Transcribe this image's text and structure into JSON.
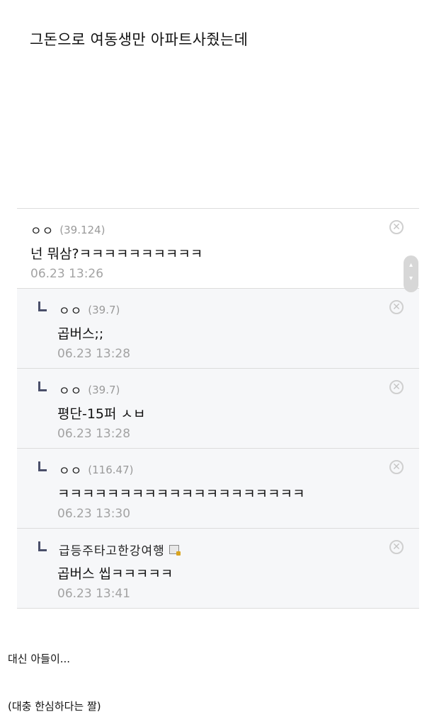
{
  "headline": "그돈으로 여동생만 아파트사줬는데",
  "delete_symbol": "✕",
  "scroll": {
    "up": "▴",
    "down": "▾"
  },
  "comments": [
    {
      "nickname": "ㅇㅇ",
      "ip": "(39.124)",
      "body": "넌 뭐삼?ㅋㅋㅋㅋㅋㅋㅋㅋㅋㅋ",
      "time": "06.23 13:26",
      "is_reply": false
    },
    {
      "nickname": "ㅇㅇ",
      "ip": "(39.7)",
      "body": "곱버스;;",
      "time": "06.23 13:28",
      "is_reply": true
    },
    {
      "nickname": "ㅇㅇ",
      "ip": "(39.7)",
      "body": "평단-15퍼 ㅅㅂ",
      "time": "06.23 13:28",
      "is_reply": true
    },
    {
      "nickname": "ㅇㅇ",
      "ip": "(116.47)",
      "body": "ㅋㅋㅋㅋㅋㅋㅋㅋㅋㅋㅋㅋㅋㅋㅋㅋㅋㅋㅋㅋ",
      "time": "06.23 13:30",
      "is_reply": true
    },
    {
      "nickname": "급등주타고한강여행",
      "ip": "",
      "body": "곱버스 씹ㅋㅋㅋㅋㅋ",
      "time": "06.23 13:41",
      "is_reply": true,
      "memo_icon": "fixed-nick-icon"
    }
  ],
  "captions": {
    "line1": "대신 아들이...",
    "line2": "(대충 한심하다는 짤)"
  }
}
